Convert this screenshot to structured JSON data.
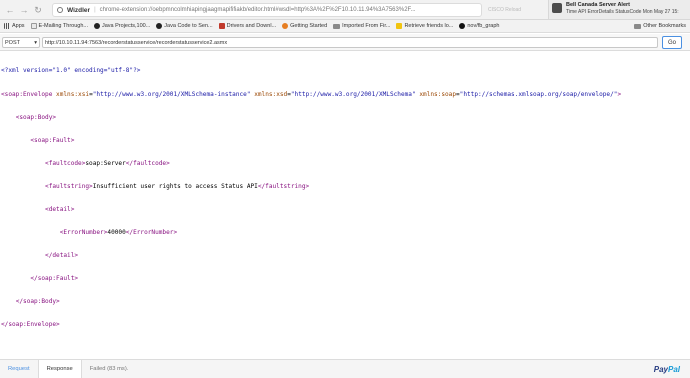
{
  "browser": {
    "omnibox": {
      "title": "Wizdler",
      "url": "chrome-extension://oebpmncolmhiapingjaagmapififiakb/editor.html#wsdl=http%3A%2F%2F10.10.11.94%3A7563%2F..."
    },
    "extensions_text": "CISCO  Reload"
  },
  "notification": {
    "title": "Bell Canada Server Alert",
    "body": "Time API ErrorDetails StatusCode Mon May 27 15:"
  },
  "bookmarks": {
    "items": [
      {
        "label": "Apps"
      },
      {
        "label": "E-Mailing Through..."
      },
      {
        "label": "Java Projects,100..."
      },
      {
        "label": "Java Code to Sen..."
      },
      {
        "label": "Drivers and Downl..."
      },
      {
        "label": "Getting Started"
      },
      {
        "label": "Imported From Fir..."
      },
      {
        "label": "Retrieve friends lo..."
      },
      {
        "label": "nov/fb_graph"
      }
    ],
    "other": "Other Bookmarks"
  },
  "request": {
    "method": "POST",
    "url": "http://10.10.11.94:7563/recorderstatusservice/recorderstatusservice2.asmx",
    "go_label": "Go"
  },
  "xml": {
    "line1_pi": "<?xml version=\"1.0\" encoding=\"utf-8\"?>",
    "env_open_tag": "<soap:Envelope",
    "attr_xsi": "xmlns:xsi",
    "val_xsi": "\"http://www.w3.org/2001/XMLSchema-instance\"",
    "attr_xsd": "xmlns:xsd",
    "val_xsd": "\"http://www.w3.org/2001/XMLSchema\"",
    "attr_soap": "xmlns:soap",
    "val_soap": "\"http://schemas.xmlsoap.org/soap/envelope/\"",
    "env_open_close": ">",
    "body_open": "<soap:Body>",
    "fault_open": "<soap:Fault>",
    "faultcode_open": "<faultcode>",
    "faultcode_value": "soap:Server",
    "faultcode_close": "</faultcode>",
    "faultstring_open": "<faultstring>",
    "faultstring_value": "Insufficient user rights to access Status API",
    "faultstring_close": "</faultstring>",
    "detail_open": "<detail>",
    "error_open": "<ErrorNumber>",
    "error_value": "40000",
    "error_close": "</ErrorNumber>",
    "detail_close": "</detail>",
    "fault_close": "</soap:Fault>",
    "body_close": "</soap:Body>",
    "env_close": "</soap:Envelope>"
  },
  "bottom": {
    "request_tab": "Request",
    "response_tab": "Response",
    "status": "Failed (83 ms).",
    "paypal_pay": "Pay",
    "paypal_pal": "Pal"
  },
  "colors": {
    "tag": "#881280",
    "attr": "#994500",
    "value": "#1a1aa6",
    "go_border": "#4a90e2",
    "request_tab": "#4a90e2"
  }
}
